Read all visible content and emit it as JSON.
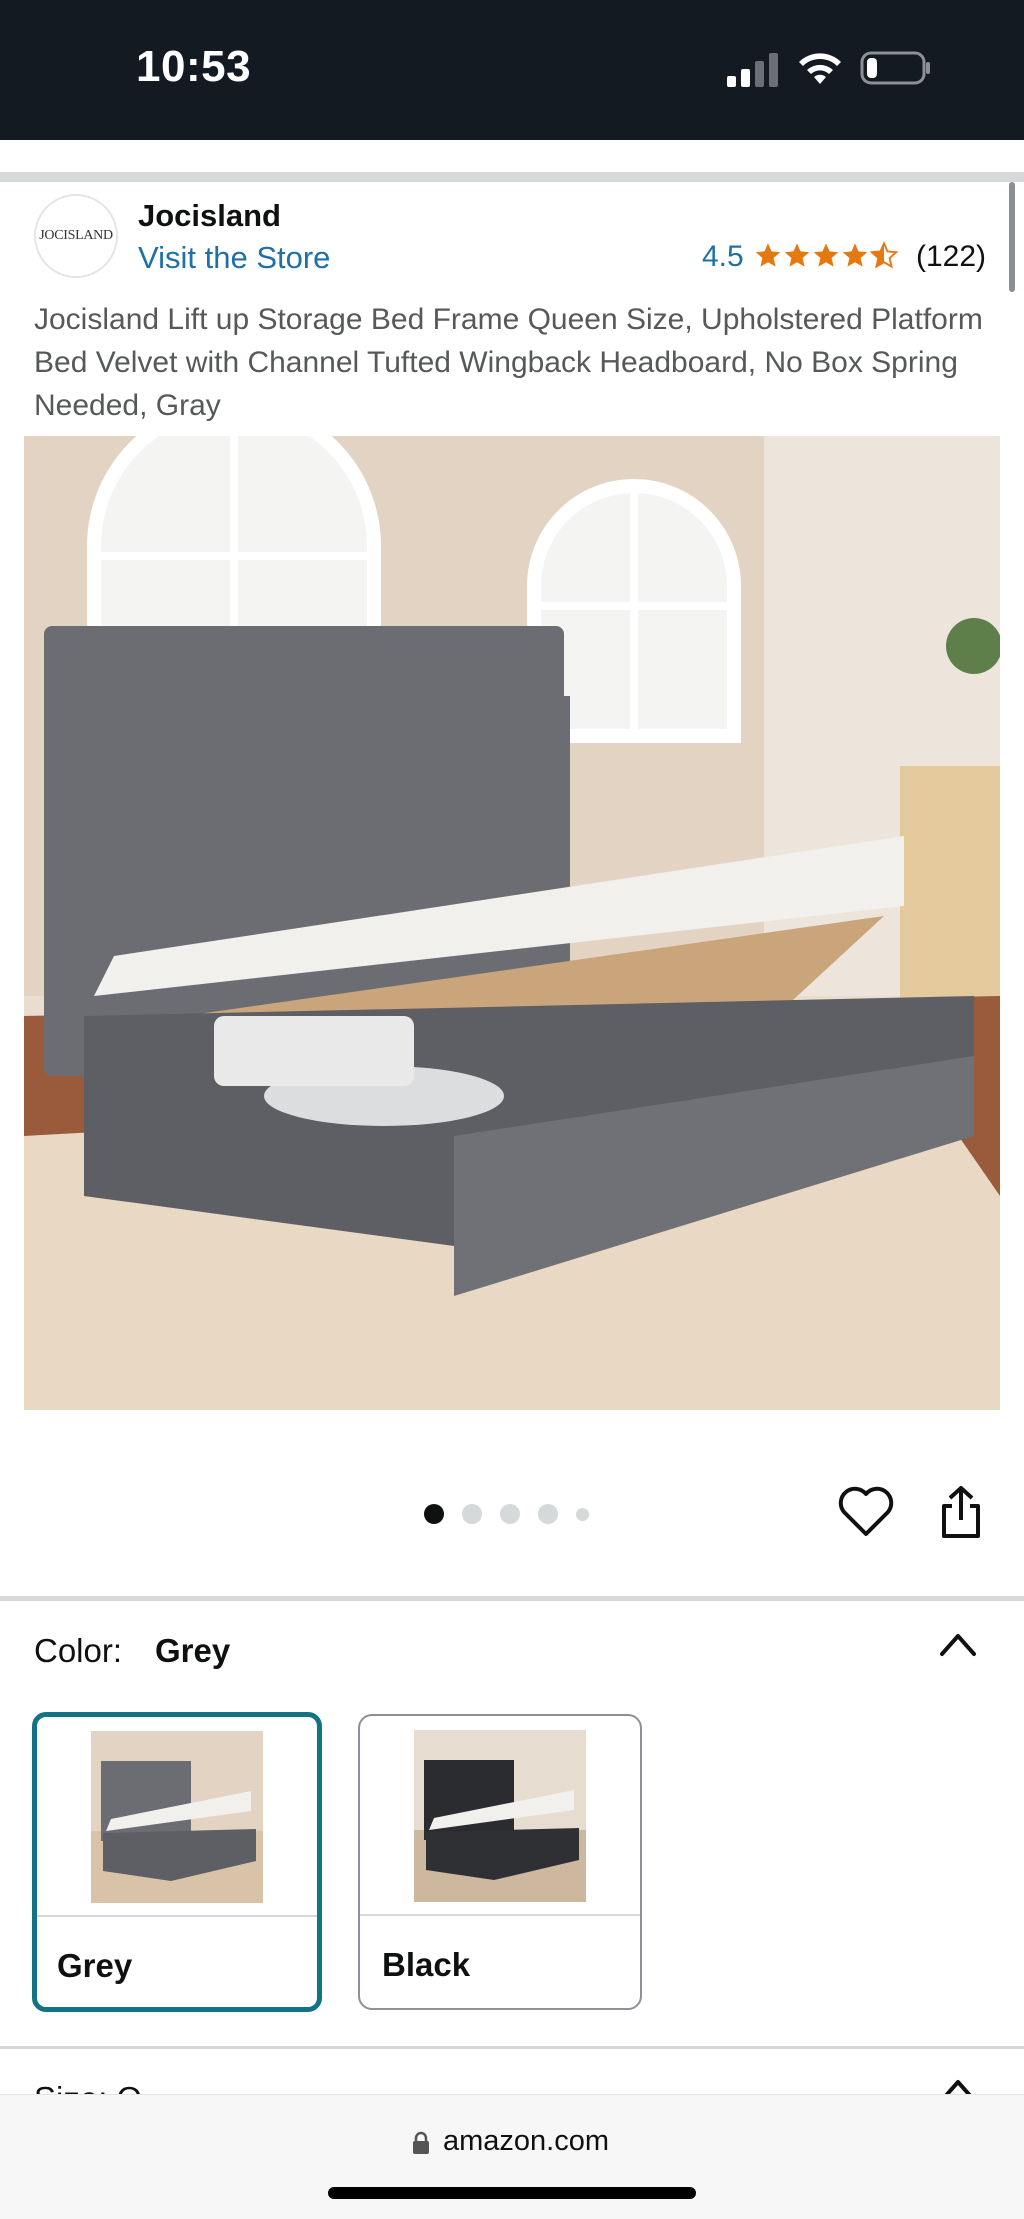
{
  "status_bar": {
    "time": "10:53"
  },
  "store": {
    "logo_text": "JOCISLAND",
    "brand": "Jocisland",
    "visit_link": "Visit the Store",
    "rating": "4.5",
    "stars": 4.5,
    "review_count": "(122)"
  },
  "product": {
    "title": "Jocisland Lift up Storage Bed Frame Queen Size, Upholstered Platform Bed Velvet with Channel Tufted Wingback Headboard, No Box Spring Needed, Gray",
    "image_count": 5,
    "active_image_index": 0
  },
  "color_section": {
    "label": "Color:",
    "selected": "Grey",
    "options": [
      {
        "label": "Grey",
        "selected": true
      },
      {
        "label": "Black",
        "selected": false
      }
    ]
  },
  "next_section": {
    "label_peek": "Size: Q"
  },
  "browser": {
    "url": "amazon.com"
  },
  "colors": {
    "status_bar_bg": "#131a22",
    "link": "#1f6fa8",
    "star": "#e47911",
    "selected_border": "#127384"
  }
}
